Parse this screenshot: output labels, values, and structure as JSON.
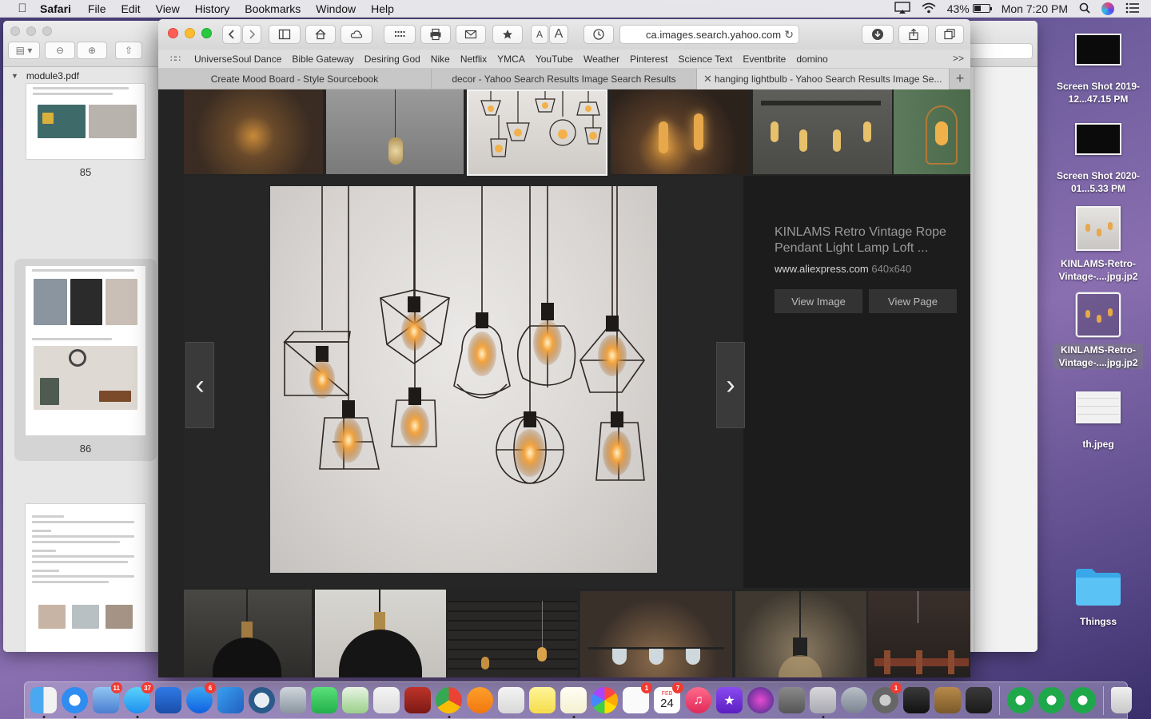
{
  "menubar": {
    "app_name": "Safari",
    "menus": [
      "File",
      "Edit",
      "View",
      "History",
      "Bookmarks",
      "Window",
      "Help"
    ],
    "battery": "43%",
    "clock": "Mon 7:20 PM"
  },
  "preview": {
    "file_title": "module3.pdf",
    "pages": [
      "85",
      "86"
    ]
  },
  "safari": {
    "url": "ca.images.search.yahoo.com",
    "favorites": [
      "UniverseSoul Dance",
      "Bible Gateway",
      "Desiring God",
      "Nike",
      "Netflix",
      "YMCA",
      "YouTube",
      "Weather",
      "Pinterest",
      "Science Text",
      "Eventbrite",
      "domino"
    ],
    "tabs": [
      {
        "title": "Create Mood Board - Style Sourcebook"
      },
      {
        "title": "decor - Yahoo Search Results Image Search Results"
      },
      {
        "title": "hanging lightbulb - Yahoo Search Results Image Se..."
      }
    ],
    "detail": {
      "title": "KINLAMS Retro Vintage Rope Pendant Light Lamp Loft ...",
      "source_site": "www.aliexpress.com",
      "dimensions": "640x640",
      "view_image": "View Image",
      "view_page": "View Page"
    }
  },
  "desktop": {
    "icons": [
      {
        "label": "Screen Shot 2019-12...47.15 PM"
      },
      {
        "label": "Screen Shot 2020-01...5.33 PM"
      },
      {
        "label": "KINLAMS-Retro-Vintage-....jpg.jp2"
      },
      {
        "label": "KINLAMS-Retro-Vintage-....jpg.jp2"
      },
      {
        "label": "th.jpeg"
      },
      {
        "label": "Thingss"
      }
    ]
  },
  "dock": {
    "badges": {
      "mail": "11",
      "messages": "37",
      "appstore": "6",
      "reminders": "1",
      "calendar_day": "24",
      "calendar_month": "FEB",
      "calendar_badge": "7",
      "sysprefs": "1"
    }
  },
  "colors": {
    "accent_red": "#fd5f57",
    "accent_yellow": "#febc2e",
    "accent_green": "#28c840",
    "desktop_purple": "#6a5a9a"
  }
}
